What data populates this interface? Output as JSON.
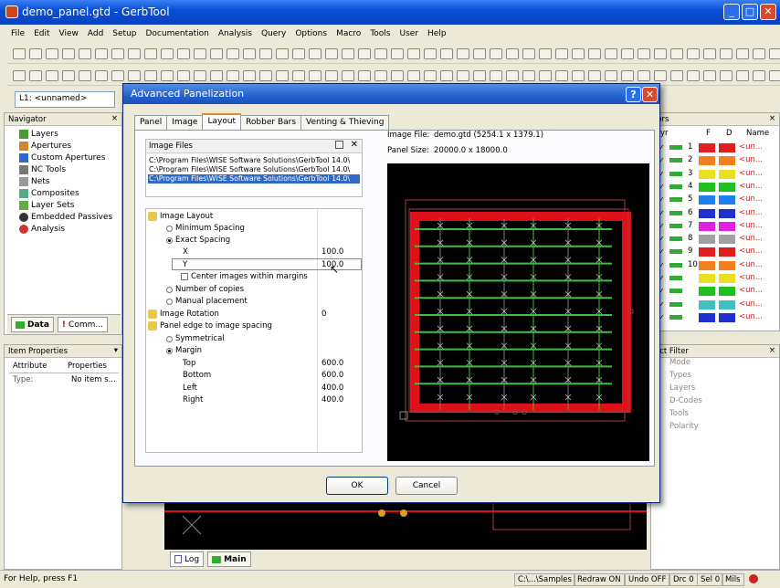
{
  "window": {
    "title": "demo_panel.gtd - GerbTool",
    "min": "_",
    "max": "□",
    "close": "✕"
  },
  "menu": [
    "File",
    "Edit",
    "View",
    "Add",
    "Setup",
    "Documentation",
    "Analysis",
    "Query",
    "Options",
    "Macro",
    "Tools",
    "User",
    "Help"
  ],
  "layer_combo": "L1: <unnamed>",
  "navigator": {
    "title": "Navigator",
    "items": [
      "Layers",
      "Apertures",
      "Custom Apertures",
      "NC Tools",
      "Nets",
      "Composites",
      "Layer Sets",
      "Embedded Passives",
      "Analysis"
    ],
    "tabs": [
      "Data",
      "Comm..."
    ]
  },
  "item_properties": {
    "title": "Item Properties",
    "headers": [
      "Attribute",
      "Properties"
    ],
    "rows": [
      [
        "Type:",
        "No item s..."
      ]
    ]
  },
  "right_layers": {
    "title": "lors",
    "headers": [
      "yr",
      "F",
      "D",
      "Name"
    ],
    "rows": [
      {
        "num": "1",
        "fill": "#e02020",
        "draw": "#e02020",
        "name": "<un..."
      },
      {
        "num": "2",
        "fill": "#f08020",
        "draw": "#f08020",
        "name": "<un..."
      },
      {
        "num": "3",
        "fill": "#e8e020",
        "draw": "#e8e020",
        "name": "<un..."
      },
      {
        "num": "4",
        "fill": "#20c020",
        "draw": "#20c020",
        "name": "<un..."
      },
      {
        "num": "5",
        "fill": "#2080f0",
        "draw": "#2080f0",
        "name": "<un..."
      },
      {
        "num": "6",
        "fill": "#2030d0",
        "draw": "#2030d0",
        "name": "<un..."
      },
      {
        "num": "7",
        "fill": "#e020e0",
        "draw": "#e020e0",
        "name": "<un..."
      },
      {
        "num": "8",
        "fill": "#a0a0a0",
        "draw": "#a0a0a0",
        "name": "<un..."
      },
      {
        "num": "9",
        "fill": "#e02020",
        "draw": "#e02020",
        "name": "<un..."
      },
      {
        "num": "10",
        "fill": "#f08020",
        "draw": "#f08020",
        "name": "<un..."
      },
      {
        "num": "",
        "fill": "#e8e020",
        "draw": "#e8e020",
        "name": "<un..."
      },
      {
        "num": "",
        "fill": "#20c020",
        "draw": "#20c020",
        "name": "<un..."
      },
      {
        "num": "",
        "fill": "#40c0c0",
        "draw": "#40c0c0",
        "name": "<un..."
      },
      {
        "num": "",
        "fill": "#2030d0",
        "draw": "#2030d0",
        "name": "<un..."
      }
    ]
  },
  "right_filter": {
    "title": "act Filter",
    "items": [
      "Mode",
      "Types",
      "Layers",
      "D-Codes",
      "Tools",
      "Polarity"
    ]
  },
  "dialog": {
    "title": "Advanced Panelization",
    "help": "?",
    "close": "✕",
    "tabs": [
      "Panel",
      "Image",
      "Layout",
      "Robber Bars",
      "Venting & Thieving"
    ],
    "active_tab": "Layout",
    "image_files_title": "Image Files",
    "image_files": [
      "C:\\Program Files\\WISE Software Solutions\\GerbTool 14.0\\",
      "C:\\Program Files\\WISE Software Solutions\\GerbTool 14.0\\",
      "C:\\Program Files\\WISE Software Solutions\\GerbTool 14.0\\"
    ],
    "tree": {
      "image_layout": "Image Layout",
      "minimum_spacing": "Minimum Spacing",
      "exact_spacing": "Exact Spacing",
      "x_label": "X",
      "x_value": "100.0",
      "y_label": "Y",
      "y_value": "100.0",
      "center_images": "Center images within margins",
      "number_of_copies": "Number of copies",
      "manual_placement": "Manual placement",
      "image_rotation": "Image Rotation",
      "image_rotation_value": "0",
      "panel_edge": "Panel edge to image spacing",
      "symmetrical": "Symmetrical",
      "margin": "Margin",
      "top": "Top",
      "top_value": "600.0",
      "bottom": "Bottom",
      "bottom_value": "600.0",
      "left": "Left",
      "left_value": "400.0",
      "right": "Right",
      "right_value": "400.0"
    },
    "image_file_label": "Image File:",
    "image_file_value": "demo.gtd (5254.1 x 1379.1)",
    "panel_size_label": "Panel Size:",
    "panel_size_value": "20000.0 x 18000.0",
    "ok": "OK",
    "cancel": "Cancel"
  },
  "bottom_tabs": [
    "Log",
    "Main"
  ],
  "status": {
    "help": "For Help, press F1",
    "path": "C:\\...\\Samples",
    "redraw": "Redraw ON",
    "undo": "Undo OFF",
    "drc": "Drc 0",
    "sel": "Sel 0",
    "units": "Mils"
  },
  "colors": {
    "accent_red": "#e0101a",
    "trace_green": "#3fbf3f",
    "board_bg": "#000000"
  }
}
